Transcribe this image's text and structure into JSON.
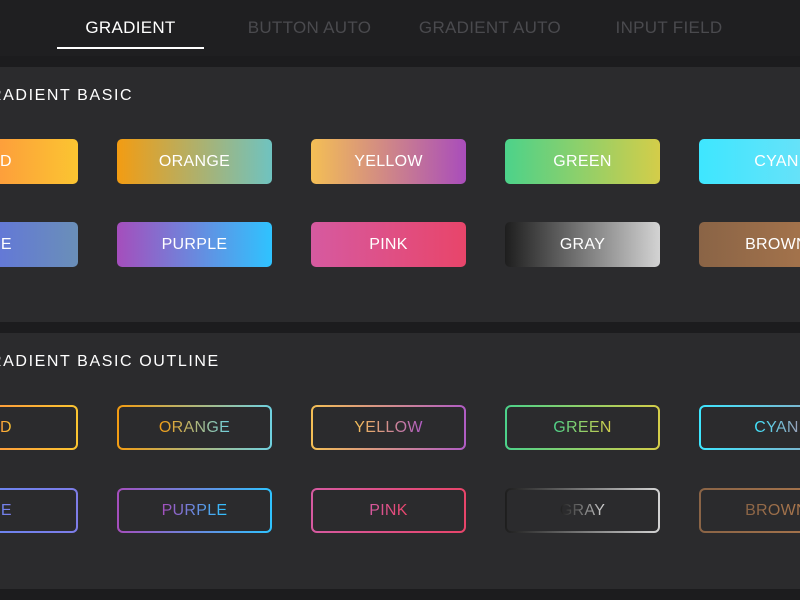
{
  "tabs": [
    {
      "label": "GRADIENT",
      "active": true
    },
    {
      "label": "BUTTON AUTO",
      "active": false
    },
    {
      "label": "GRADIENT AUTO",
      "active": false
    },
    {
      "label": "INPUT FIELD",
      "active": false
    }
  ],
  "sections": {
    "basic": {
      "title": "RADIENT  BASIC",
      "row1": [
        {
          "label": "ED",
          "gradient": [
            "#ff7a45",
            "#fbc531"
          ]
        },
        {
          "label": "ORANGE",
          "gradient": [
            "#f39c12",
            "#6fc3c0"
          ]
        },
        {
          "label": "YELLOW",
          "gradient": [
            "#f4bf55",
            "#a94dbb"
          ]
        },
        {
          "label": "GREEN",
          "gradient": [
            "#4cd28a",
            "#d4cd49"
          ]
        },
        {
          "label": "CYAN",
          "gradient": [
            "#3ee6ff",
            "#7be0f5"
          ]
        }
      ],
      "row2": [
        {
          "label": "UE",
          "gradient": [
            "#5d63f4",
            "#6a8fb8"
          ]
        },
        {
          "label": "PURPLE",
          "gradient": [
            "#a54ebc",
            "#2fc3ff"
          ]
        },
        {
          "label": "PINK",
          "gradient": [
            "#d65aa0",
            "#e8456a"
          ]
        },
        {
          "label": "GRAY",
          "gradient": [
            "#1e1e1e",
            "#d3d3d3"
          ]
        },
        {
          "label": "BROWN",
          "gradient": [
            "#8a6446",
            "#b07a4e"
          ]
        }
      ]
    },
    "outline": {
      "title": "RADIENT  BASIC  OUTLINE",
      "row1": [
        {
          "label": "ED",
          "gradient": [
            "#ff7a45",
            "#fbc531"
          ]
        },
        {
          "label": "ORANGE",
          "gradient": [
            "#f39c12",
            "#6fd1e0"
          ]
        },
        {
          "label": "YELLOW",
          "gradient": [
            "#f4bf55",
            "#b05cc4"
          ]
        },
        {
          "label": "GREEN",
          "gradient": [
            "#4cd28a",
            "#d4cd49"
          ]
        },
        {
          "label": "CYAN",
          "gradient": [
            "#3ee6ff",
            "#9aa0b8"
          ]
        }
      ],
      "row2": [
        {
          "label": "UE",
          "gradient": [
            "#5d8af4",
            "#7e7de8"
          ]
        },
        {
          "label": "PURPLE",
          "gradient": [
            "#a54ebc",
            "#2fc3ff"
          ]
        },
        {
          "label": "PINK",
          "gradient": [
            "#d65aa0",
            "#e8456a"
          ]
        },
        {
          "label": "GRAY",
          "gradient": [
            "#1e1e1e",
            "#d3d3d3"
          ]
        },
        {
          "label": "BROWN",
          "gradient": [
            "#8a6446",
            "#b07a4e"
          ]
        }
      ]
    }
  }
}
